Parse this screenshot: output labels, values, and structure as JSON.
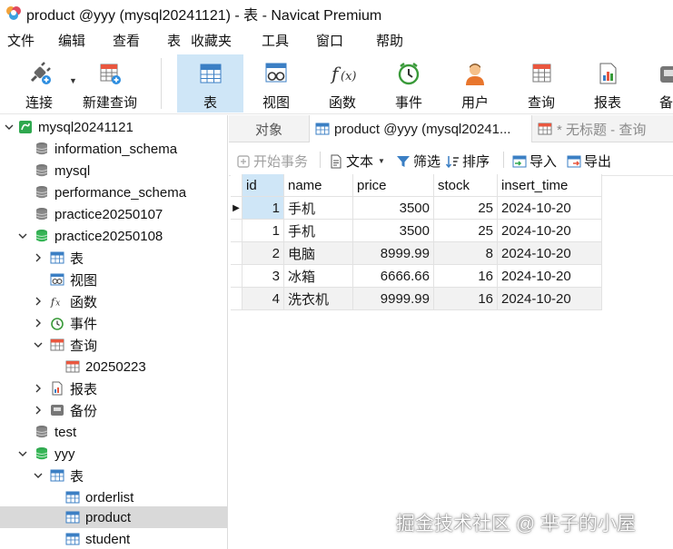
{
  "window": {
    "title": "product @yyy (mysql20241121) - 表 - Navicat Premium"
  },
  "menu": [
    "文件",
    "编辑",
    "查看",
    "表",
    "收藏夹",
    "工具",
    "窗口",
    "帮助"
  ],
  "toolbar": {
    "connect": "连接",
    "new_query": "新建查询",
    "table": "表",
    "view": "视图",
    "function": "函数",
    "event": "事件",
    "user": "用户",
    "query": "查询",
    "report": "报表",
    "backup_cut": "备"
  },
  "tree": {
    "connection": "mysql20241121",
    "dbs": {
      "information_schema": "information_schema",
      "mysql": "mysql",
      "performance_schema": "performance_schema",
      "practice20250107": "practice20250107",
      "practice20250108": "practice20250108",
      "test": "test",
      "yyy": "yyy"
    },
    "practice20250108_children": {
      "tables": "表",
      "views": "视图",
      "functions": "函数",
      "events": "事件",
      "queries": "查询",
      "query_item": "20250223",
      "reports": "报表",
      "backups": "备份"
    },
    "yyy_children": {
      "tables": "表",
      "orderlist": "orderlist",
      "product": "product",
      "student": "student"
    }
  },
  "tabs": {
    "objects": "对象",
    "product": "product @yyy (mysql20241...",
    "untitled": "* 无标题 - 查询"
  },
  "subtoolbar": {
    "begin_transaction": "开始事务",
    "text": "文本",
    "filter": "筛选",
    "sort": "排序",
    "import": "导入",
    "export": "导出"
  },
  "grid": {
    "columns": [
      "id",
      "name",
      "price",
      "stock",
      "insert_time"
    ],
    "rows": [
      [
        "1",
        "手机",
        "3500",
        "25",
        "2024-10-20"
      ],
      [
        "1",
        "手机",
        "3500",
        "25",
        "2024-10-20"
      ],
      [
        "2",
        "电脑",
        "8999.99",
        "8",
        "2024-10-20"
      ],
      [
        "3",
        "冰箱",
        "6666.66",
        "16",
        "2024-10-20"
      ],
      [
        "4",
        "洗衣机",
        "9999.99",
        "16",
        "2024-10-20"
      ]
    ]
  },
  "watermark": "掘金技术社区 @ 芈子的小屋",
  "colors": {
    "selection": "#cfe6f7",
    "db_green": "#2fa84f",
    "tree_selected": "#d9d9d9"
  }
}
